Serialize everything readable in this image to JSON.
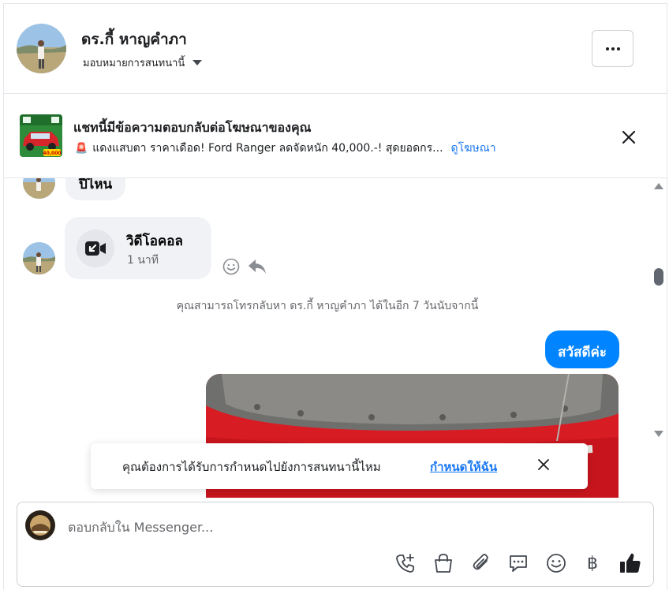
{
  "header": {
    "contact_name": "ดร.กี้ หาญคำภา",
    "assign_label": "มอบหมายการสนทนานี้",
    "more_label": "More"
  },
  "ad_banner": {
    "title": "แชทนี้มีข้อความตอบกลับต่อโฆษณาของคุณ",
    "description": "แดงแสบตา ราคาเดือด! Ford Ranger ลดจัดหนัก 40,000.-! สุดยอดกร...",
    "view_ad_label": "ดูโฆษณา",
    "thumb_caption": "40,000"
  },
  "messages": {
    "prev_text": "ปีไหน",
    "call": {
      "title": "วิดีโอคอล",
      "duration": "1 นาที"
    },
    "system_note": "คุณสามารถโทรกลับหา ดร.กี้ หาญคำภา ได้ในอีก 7 วันนับจากนี้",
    "outgoing_text": "สวัสดีค่ะ"
  },
  "toast": {
    "text": "คุณต้องการได้รับการกำหนดไปยังการสนทนานี้ไหม",
    "link": "กำหนดให้ฉัน"
  },
  "composer": {
    "placeholder": "ตอบกลับใน Messenger...",
    "baht_symbol": "฿"
  },
  "colors": {
    "accent": "#0084ff",
    "link": "#1877f2",
    "bubble_in": "#f0f2f5"
  }
}
